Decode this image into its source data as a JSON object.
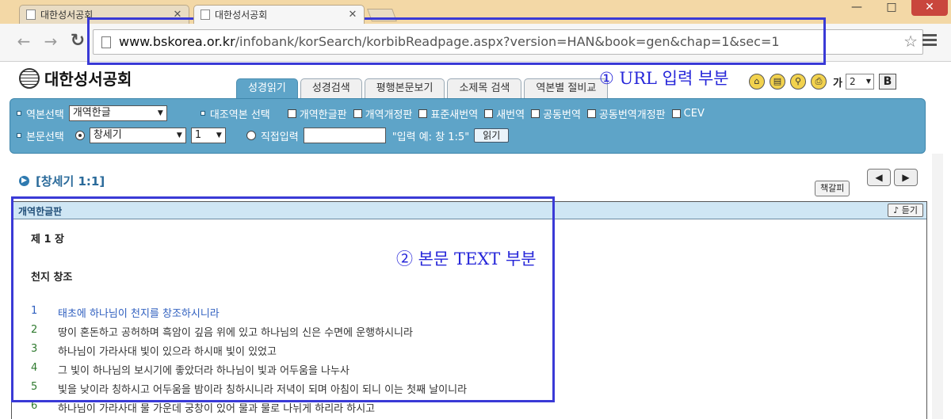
{
  "browser": {
    "tabs": [
      {
        "title": "대한성서공회",
        "active": false
      },
      {
        "title": "대한성서공회",
        "active": true
      }
    ],
    "window_buttons": {
      "minimize": "—",
      "maximize": "□",
      "close": "✕"
    },
    "url_host": "www.bskorea.or.kr",
    "url_path": "/infobank/korSearch/korbibReadpage.aspx?version=HAN&book=gen&chap=1&sec=1"
  },
  "annotations": {
    "url_label": "① URL 입력 부분",
    "text_label": "② 본문 TEXT 부분",
    "box_color": "#3a3ad6"
  },
  "site": {
    "logo_text": "대한성서공회",
    "nav_tabs": [
      {
        "label": "성경읽기",
        "active": true
      },
      {
        "label": "성경검색",
        "active": false
      },
      {
        "label": "평행본문보기",
        "active": false
      },
      {
        "label": "소제목 검색",
        "active": false
      },
      {
        "label": "역본별 절비교",
        "active": false
      }
    ],
    "tools": {
      "home_icon": "home-icon",
      "print_icon": "printer-icon",
      "fontsize_label": "가",
      "fontsize_value": "2",
      "bold_label": "B"
    }
  },
  "panel": {
    "version_label": "역본선택",
    "version_value": "개역한글",
    "compare_label": "대조역본 선택",
    "compare_options": [
      "개역한글판",
      "개역개정판",
      "표준새번역",
      "새번역",
      "공동번역",
      "공동번역개정판",
      "CEV"
    ],
    "text_label": "본문선택",
    "book_value": "창세기",
    "chapter_value": "1",
    "direct_label": "직접입력",
    "direct_hint": "\"입력 예: 창 1:5\"",
    "read_button": "읽기"
  },
  "reading": {
    "reference": "[창세기 1:1]",
    "bookmark_button": "책갈피",
    "prev_button": "◀",
    "next_button": "▶",
    "version_title": "개역한글판",
    "listen_button": "듣기",
    "chapter_title": "제 1 장",
    "section_title": "천지 창조",
    "verses": [
      {
        "num": "1",
        "text": "태초에 하나님이 천지를 창조하시니라"
      },
      {
        "num": "2",
        "text": "땅이 혼돈하고 공허하며 흑암이 깊음 위에 있고 하나님의 신은 수면에 운행하시니라"
      },
      {
        "num": "3",
        "text": "하나님이 가라사대 빛이 있으라 하시매 빛이 있었고"
      },
      {
        "num": "4",
        "text": "그 빛이 하나님의 보시기에 좋았더라 하나님이 빛과 어두움을 나누사"
      },
      {
        "num": "5",
        "text": "빛을 낮이라 칭하시고 어두움을 밤이라 칭하시니라 저녁이 되며 아침이 되니 이는 첫째 날이니라"
      },
      {
        "num": "6",
        "text": "하나님이 가라사대 물 가운데 궁창이 있어 물과 물로 나뉘게 하리라 하시고"
      }
    ]
  }
}
